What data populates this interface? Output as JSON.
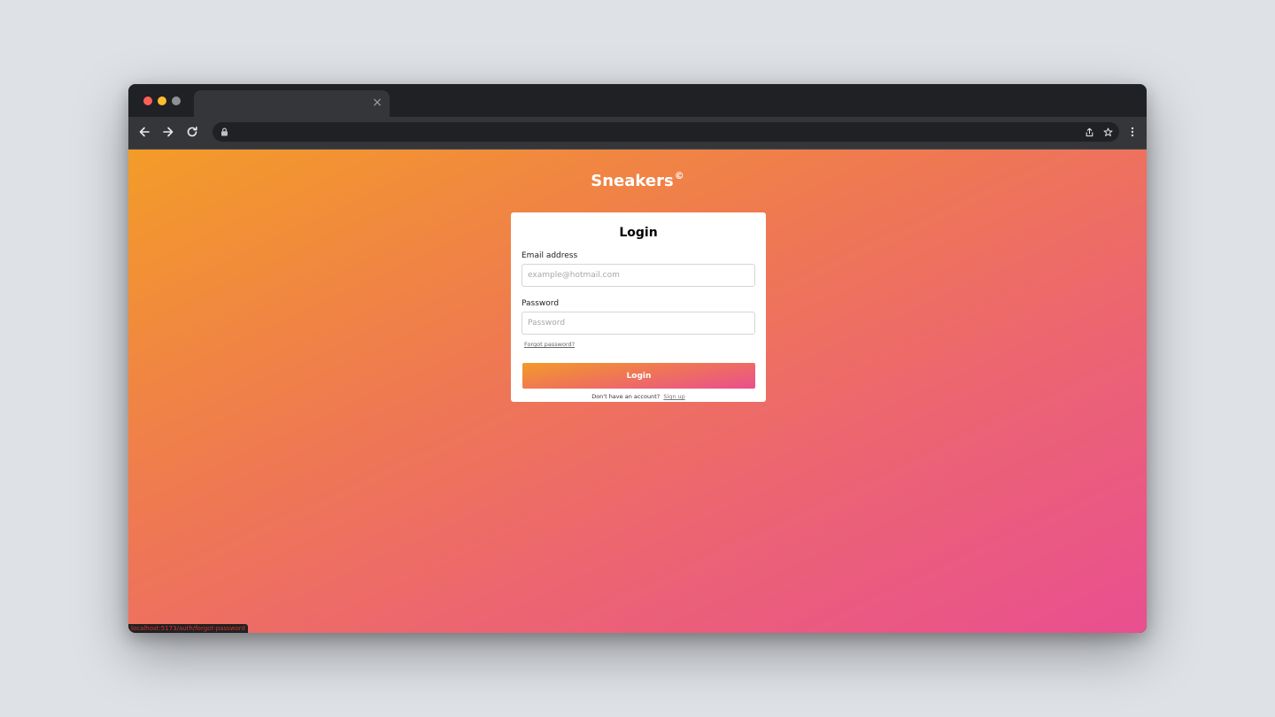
{
  "browser": {
    "tab_close": "×",
    "lights": [
      "#ff5f57",
      "#febc2e",
      "#8e8f93"
    ]
  },
  "icons": {
    "back": "arrow-left-icon",
    "forward": "arrow-right-icon",
    "reload": "reload-icon",
    "lock": "lock-icon",
    "share": "share-icon",
    "bookmark": "star-icon",
    "menu": "kebab-menu-icon"
  },
  "page": {
    "brand": "Sneakers",
    "brand_mark": "©",
    "login": {
      "title": "Login",
      "email_label": "Email address",
      "email_placeholder": "example@hotmail.com",
      "email_value": "",
      "password_label": "Password",
      "password_placeholder": "Password",
      "password_value": "",
      "forgot_link": "Forgot password?",
      "submit_label": "Login",
      "signup_prompt": "Don't have an account?",
      "signup_link": "Sign up"
    },
    "status_bar_url": "localhost:5173/auth/forgot-password"
  },
  "colors": {
    "gradient_start": "#f39c28",
    "gradient_end": "#e94f90"
  }
}
